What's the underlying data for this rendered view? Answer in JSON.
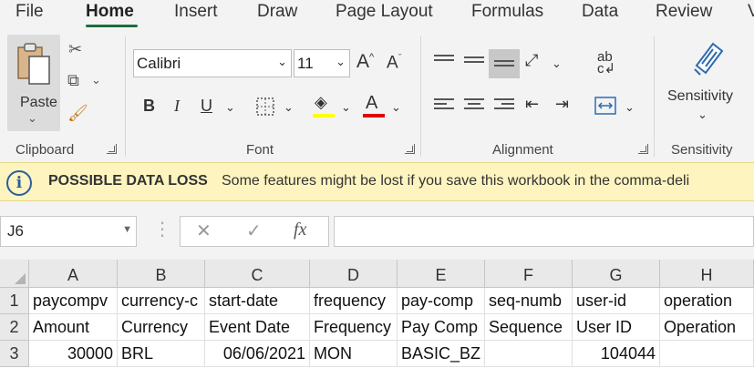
{
  "menu": {
    "tabs": [
      "File",
      "Home",
      "Insert",
      "Draw",
      "Page Layout",
      "Formulas",
      "Data",
      "Review",
      "V"
    ],
    "active": "Home"
  },
  "ribbon": {
    "clipboard": {
      "label": "Clipboard",
      "paste_label": "Paste"
    },
    "font": {
      "label": "Font",
      "font_name": "Calibri",
      "font_size": "11",
      "grow_label": "A",
      "shrink_label": "A",
      "bold": "B",
      "italic": "I",
      "underline": "U",
      "font_color_label": "A",
      "highlight_color": "#ffff00",
      "font_color": "#e00000"
    },
    "alignment": {
      "label": "Alignment"
    },
    "sensitivity": {
      "label": "Sensitivity",
      "button_label": "Sensitivity"
    }
  },
  "infobar": {
    "title": "POSSIBLE DATA LOSS",
    "message": "Some features might be lost if you save this workbook in the comma-deli"
  },
  "formula_bar": {
    "name_box": "J6",
    "cancel": "✕",
    "enter": "✓",
    "fx": "fx"
  },
  "grid": {
    "columns": [
      "A",
      "B",
      "C",
      "D",
      "E",
      "F",
      "G",
      "H"
    ],
    "row_numbers": [
      "1",
      "2",
      "3"
    ],
    "rows": [
      [
        "paycompv",
        "currency-c",
        "start-date",
        "frequency",
        "pay-comp",
        "seq-numb",
        "user-id",
        "operation"
      ],
      [
        "Amount",
        "Currency",
        "Event Date",
        "Frequency",
        "Pay Comp",
        "Sequence",
        "User ID",
        "Operation"
      ],
      [
        "30000",
        "BRL",
        "06/06/2021",
        "MON",
        "BASIC_BZ",
        "",
        "104044",
        ""
      ]
    ]
  }
}
